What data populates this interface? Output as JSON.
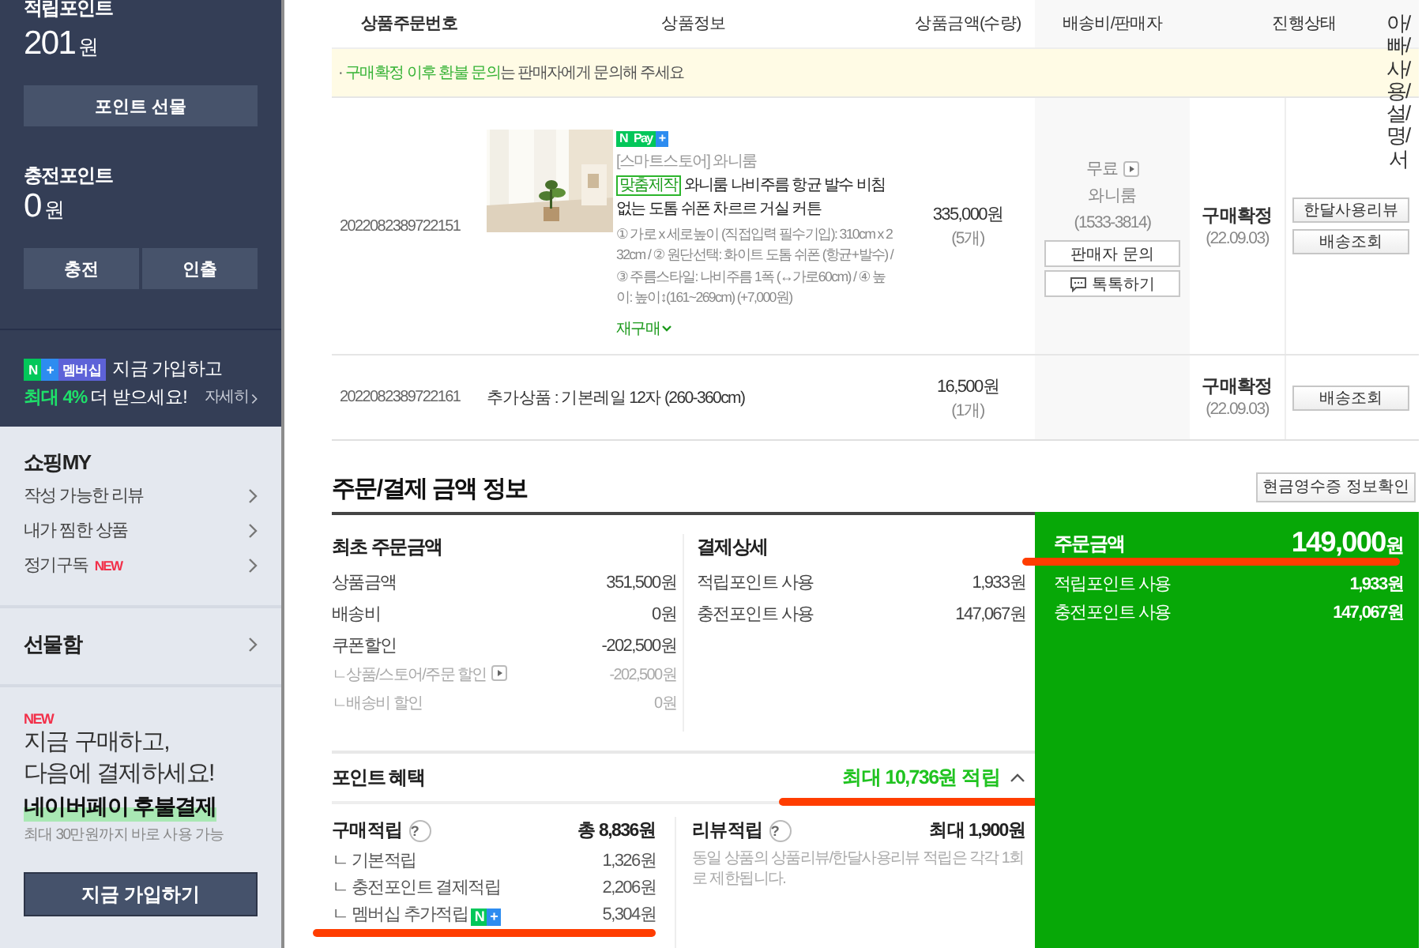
{
  "sidebar": {
    "points": {
      "label": "적립포인트",
      "amount": "201",
      "unit": "원",
      "buttons": [
        "포인트 선물"
      ]
    },
    "charge": {
      "label": "충전포인트",
      "amount": "0",
      "unit": "원",
      "buttons": [
        "충전",
        "인출"
      ]
    },
    "membership": {
      "badge": {
        "n": "N",
        "plus": "+",
        "label": "멤버십"
      },
      "line1": "지금 가입하고",
      "highlight": "최대 4%",
      "line2": "더 받으세요!",
      "link": "자세히"
    },
    "shopping_my": {
      "title": "쇼핑MY",
      "items": [
        {
          "label": "작성 가능한 리뷰"
        },
        {
          "label": "내가 찜한 상품"
        },
        {
          "label": "정기구독",
          "badge": "NEW"
        }
      ]
    },
    "gift_box": {
      "title": "선물함"
    },
    "promo": {
      "badge": "NEW",
      "lines": [
        "지금 구매하고,",
        "다음에 결제하세요!"
      ],
      "highlight": "네이버페이 후불결제",
      "note": "최대 30만원까지 바로 사용 가능",
      "button": "지금 가입하기"
    }
  },
  "order_table": {
    "columns": [
      "상품주문번호",
      "상품정보",
      "상품금액(수량)",
      "배송비/판매자",
      "진행상태"
    ],
    "notice": {
      "bullet": "·",
      "emphasis": "구매확정 이후 환불 문의",
      "text": "는 판매자에게 문의해 주세요"
    },
    "rows": [
      {
        "kind": "product",
        "order_no": "2022082389722151",
        "image": {
          "kind": "picture"
        },
        "pay_badge": {
          "n": "N",
          "label": "Pay",
          "plus": "+"
        },
        "store": "[스마트스토어] 와니룸",
        "tag": "맞춤제작",
        "title": "와니룸 나비주름 항균 발수 비침없는 도톰 쉬폰 차르르 거실 커튼",
        "options": "① 가로 x 세로높이 (직접입력 필수기입): 310cm x 232cm / ② 원단선택: 화이트 도톰 쉬폰 (항균+발수) / ③ 주름스타일: 나비주름 1폭 (↔가로60cm) / ④ 높이: 높이↕(161~269cm) (+7,000원)",
        "rebuy": "재구매",
        "price": "335,000원",
        "qty": "(5개)",
        "shipping": {
          "fee": "무료",
          "seller": "와니룸",
          "phone": "(1533-3814)",
          "buttons": [
            {
              "kind": "plain",
              "label": "판매자 문의"
            },
            {
              "kind": "chat",
              "label": "톡톡하기"
            }
          ]
        },
        "status": "구매확정",
        "date": "(22.09.03)",
        "actions": [
          "한달사용리뷰",
          "배송조회"
        ]
      },
      {
        "kind": "addon",
        "order_no": "2022082389722161",
        "title": "추가상품 : 기본레일 12자 (260-360cm)",
        "price": "16,500원",
        "qty": "(1개)",
        "status": "구매확정",
        "date": "(22.09.03)",
        "actions": [
          "배송조회"
        ]
      }
    ]
  },
  "vertical_note": "아/빠/사/용/설/명/서",
  "payment": {
    "title": "주문/결제 금액 정보",
    "receipt_button": "현금영수증 정보확인",
    "original": {
      "title": "최초 주문금액",
      "rows": [
        {
          "kind": "main",
          "label": "상품금액",
          "value": "351,500원"
        },
        {
          "kind": "main",
          "label": "배송비",
          "value": "0원"
        },
        {
          "kind": "main",
          "label": "쿠폰할인",
          "value": "-202,500원"
        },
        {
          "kind": "sub",
          "label": "ㄴ상품/스토어/주문 할인",
          "value": "-202,500원",
          "info": true
        },
        {
          "kind": "sub",
          "label": "ㄴ배송비 할인",
          "value": "0원"
        }
      ]
    },
    "detail": {
      "title": "결제상세",
      "rows": [
        {
          "label": "적립포인트 사용",
          "value": "1,933원"
        },
        {
          "label": "충전포인트 사용",
          "value": "147,067원"
        }
      ]
    },
    "total": {
      "label": "주문금액",
      "amount": "149,000",
      "unit": "원",
      "marked": true,
      "rows": [
        {
          "label": "적립포인트 사용",
          "value": "1,933원"
        },
        {
          "label": "충전포인트 사용",
          "value": "147,067원"
        }
      ]
    },
    "benefits": {
      "title": "포인트 혜택",
      "summary": "최대 10,736원 적립",
      "expanded": true,
      "marked": true,
      "purchase": {
        "title": "구매적립",
        "help": "?",
        "total": "총 8,836원",
        "rows": [
          {
            "label": "ㄴ 기본적립",
            "value": "1,326원",
            "marked": false
          },
          {
            "label": "ㄴ 충전포인트 결제적립",
            "value": "2,206원",
            "marked": false
          },
          {
            "label": "ㄴ 멤버십 추가적립",
            "value": "5,304원",
            "badge": {
              "n": "N",
              "plus": "+"
            },
            "marked": true
          }
        ]
      },
      "review": {
        "title": "리뷰적립",
        "help": "?",
        "total": "최대 1,900원",
        "note": "동일 상품의 상품리뷰/한달사용리뷰 적립은 각각 1회로 제한됩니다."
      }
    }
  }
}
